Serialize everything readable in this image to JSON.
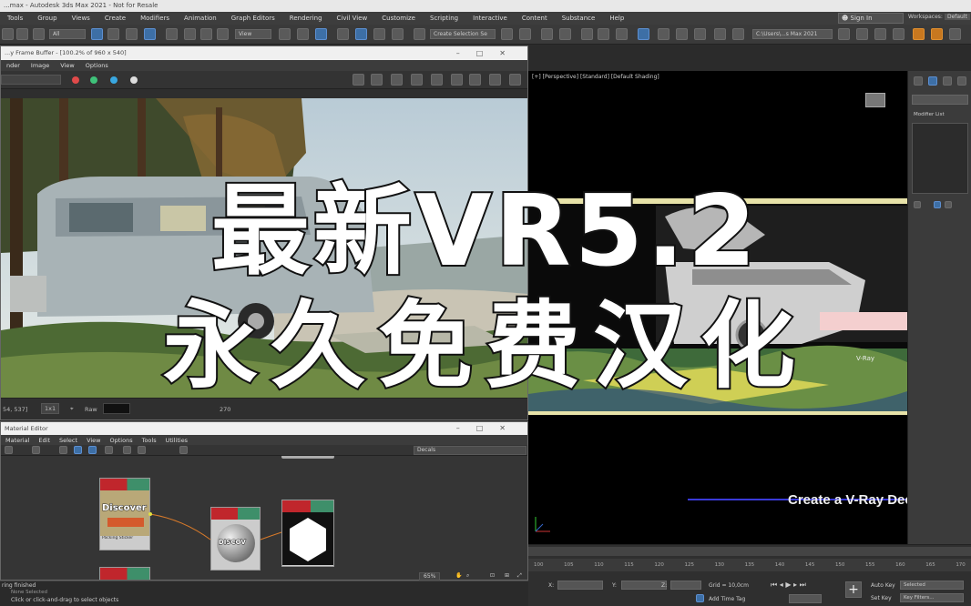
{
  "window": {
    "title": "...max - Autodesk 3ds Max 2021 - Not for Resale"
  },
  "menubar": {
    "items": [
      "Tools",
      "Group",
      "Views",
      "Create",
      "Modifiers",
      "Animation",
      "Graph Editors",
      "Rendering",
      "Civil View",
      "Customize",
      "Scripting",
      "Interactive",
      "Content",
      "Substance",
      "Help"
    ],
    "signin": "Sign In",
    "workspaces_label": "Workspaces:",
    "workspaces_value": "Default"
  },
  "toolbar": {
    "filter_value": "All",
    "view_value": "View",
    "selection_set": "Create Selection Se",
    "path_value": "C:\\Users\\...s Max 2021"
  },
  "frame_buffer": {
    "title": "...y Frame Buffer - [100.2% of 960 x 540]",
    "menu": [
      "nder",
      "Image",
      "View",
      "Options"
    ],
    "status_coords": "54, 537]",
    "status_zoom": "1x1",
    "status_raw": "Raw",
    "status_val": "270",
    "dot_colors": [
      "#e04a4a",
      "#3fc27a",
      "#39a7e0"
    ]
  },
  "viewport": {
    "label": "[+] [Perspective] [Standard] [Default Shading]",
    "banner": "Create a V-Ray Dec",
    "watermark": "V-Ray"
  },
  "command_panel": {
    "modifier_list": "Modifier List"
  },
  "material_editor": {
    "title": "Material Editor",
    "menu": [
      "Material",
      "Edit",
      "Select",
      "View",
      "Options",
      "Tools",
      "Utilities"
    ],
    "dropdown": "Decals",
    "node1_label": "Discover",
    "node1_caption": "Packing Sticker",
    "node2_label": "DISCOV"
  },
  "statusbar": {
    "line1": "ring finished",
    "line2": "None Selected",
    "line3": "Click or click-and-drag to select objects",
    "zoom": "65%"
  },
  "timeline": {
    "ticks": [
      "100",
      "105",
      "110",
      "115",
      "120",
      "125",
      "130",
      "135",
      "140",
      "145",
      "150",
      "155",
      "160",
      "165",
      "170"
    ],
    "x_label": "X:",
    "y_label": "Y:",
    "z_label": "Z:",
    "grid": "Grid = 10,0cm",
    "add_time_tag": "Add Time Tag",
    "auto_key": "Auto Key",
    "set_key": "Set Key",
    "selected": "Selected",
    "key_filters": "Key Filters..."
  },
  "overlay": {
    "line1": "最新VR5.2",
    "line2": "永久免费汉化"
  }
}
